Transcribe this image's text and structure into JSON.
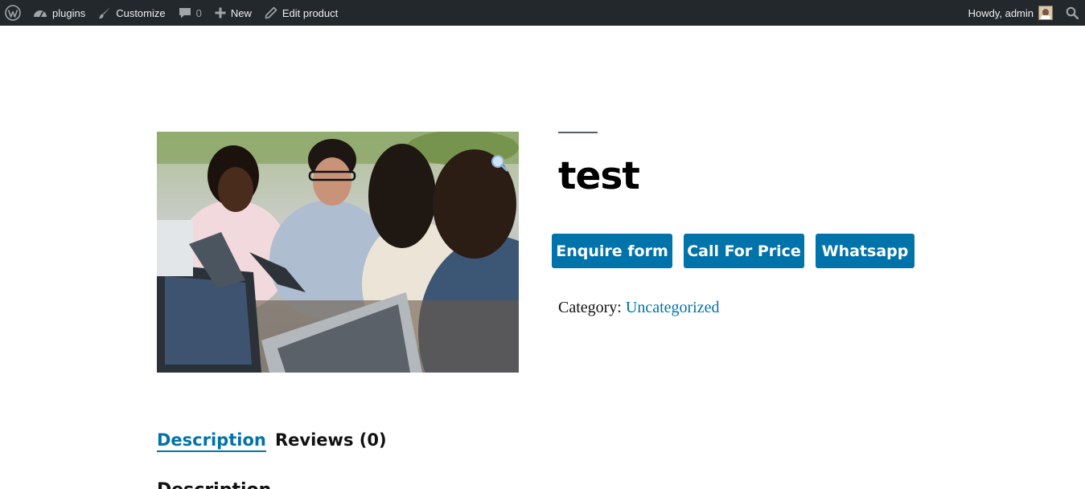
{
  "adminbar": {
    "site_name": "plugins",
    "customize": "Customize",
    "comments_count": "0",
    "new": "New",
    "edit_product": "Edit product",
    "greeting": "Howdy, admin"
  },
  "product": {
    "title": "test",
    "category_label": "Category:",
    "category_link": "Uncategorized"
  },
  "buttons": {
    "enquire": "Enquire form",
    "call": "Call For Price",
    "whatsapp": "Whatsapp"
  },
  "tabs": [
    {
      "label": "Description",
      "active": true
    },
    {
      "label": "Reviews (0)",
      "active": false
    }
  ],
  "section": {
    "heading": "Description"
  },
  "colors": {
    "accent": "#0073aa",
    "adminbar_bg": "#23282d"
  },
  "icons": [
    "wordpress-logo-icon",
    "dashboard-icon",
    "brush-icon",
    "comment-icon",
    "plus-icon",
    "pencil-icon",
    "search-icon",
    "zoom-icon"
  ]
}
